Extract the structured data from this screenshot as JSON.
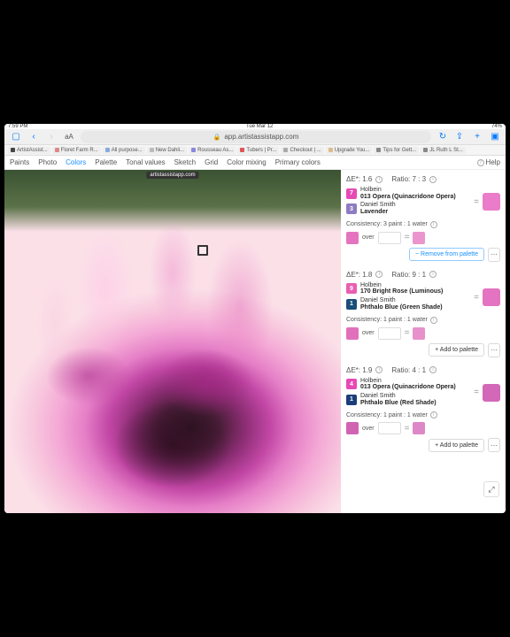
{
  "statusbar": {
    "time": "7:59 PM",
    "date": "Tue Mar 12",
    "battery": "74%"
  },
  "browser": {
    "url": "app.artistassistapp.com",
    "aa": "aA",
    "bookmarks": [
      {
        "label": "ArtistAssist...",
        "color": "#444"
      },
      {
        "label": "Floret Farm R...",
        "color": "#d88"
      },
      {
        "label": "All purpose...",
        "color": "#8ad"
      },
      {
        "label": "New Dahli...",
        "color": "#bbb"
      },
      {
        "label": "Rousseau As...",
        "color": "#88d"
      },
      {
        "label": "Tubers | Pr...",
        "color": "#d55"
      },
      {
        "label": "Checkout | ...",
        "color": "#aaa"
      },
      {
        "label": "Upgrade You...",
        "color": "#db8"
      },
      {
        "label": "Tips for Gett...",
        "color": "#888"
      },
      {
        "label": "JL Ruth L St...",
        "color": "#888"
      }
    ]
  },
  "app": {
    "tabs": [
      "Paints",
      "Photo",
      "Colors",
      "Palette",
      "Tonal values",
      "Sketch",
      "Grid",
      "Color mixing",
      "Primary colors"
    ],
    "activeTab": "Colors",
    "help": "Help"
  },
  "tooltip": "artistassistapp.com",
  "mixes": [
    {
      "delta": "ΔE*: 1.6",
      "ratio": "Ratio: 7 : 3",
      "paints": [
        {
          "n": "7",
          "color": "#e64ab5",
          "brand": "Holbein",
          "name": "013 Opera (Quinacridone Opera)"
        },
        {
          "n": "3",
          "color": "#8e7cc3",
          "brand": "Daniel Smith",
          "name": "Lavender"
        }
      ],
      "result": "#ea7cc9",
      "consistency": "Consistency:  3 paint : 1 water",
      "swatch": "#e574c0",
      "over": "over",
      "resultOver": "#ec94ce",
      "action": "− Remove from palette",
      "actionType": "remove"
    },
    {
      "delta": "ΔE*: 1.8",
      "ratio": "Ratio: 9 : 1",
      "paints": [
        {
          "n": "9",
          "color": "#e85fb2",
          "brand": "Holbein",
          "name": "170 Bright Rose (Luminous)"
        },
        {
          "n": "1",
          "color": "#1a4e7a",
          "brand": "Daniel Smith",
          "name": "Phthalo Blue (Green Shade)"
        }
      ],
      "result": "#e474c2",
      "consistency": "Consistency:  1 paint : 1 water",
      "swatch": "#e170bb",
      "over": "over",
      "resultOver": "#e890cc",
      "action": "+  Add to palette",
      "actionType": "add"
    },
    {
      "delta": "ΔE*: 1.9",
      "ratio": "Ratio: 4 : 1",
      "paints": [
        {
          "n": "4",
          "color": "#e64ab5",
          "brand": "Holbein",
          "name": "013 Opera (Quinacridone Opera)"
        },
        {
          "n": "1",
          "color": "#1a3e7a",
          "brand": "Daniel Smith",
          "name": "Phthalo Blue (Red Shade)"
        }
      ],
      "result": "#d368b8",
      "consistency": "Consistency:  1 paint : 1 water",
      "swatch": "#d064b3",
      "over": "over",
      "resultOver": "#dd88c6",
      "action": "+  Add to palette",
      "actionType": "add"
    }
  ]
}
